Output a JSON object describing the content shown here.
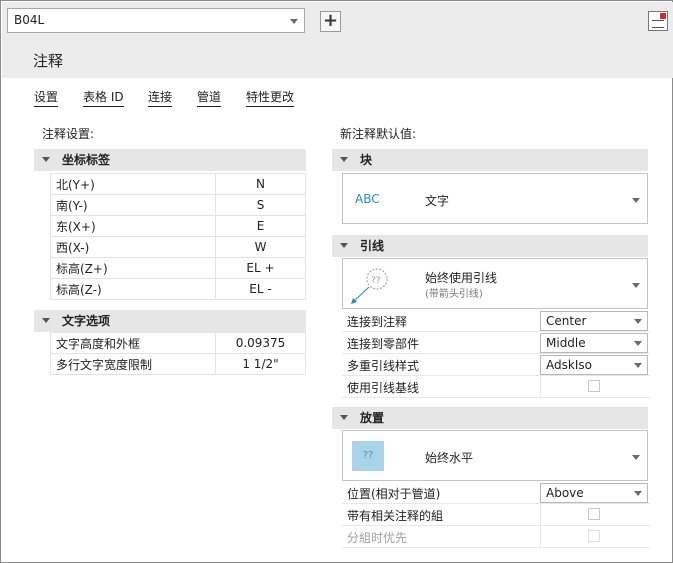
{
  "toolbar": {
    "style_combo_value": "B04L",
    "add_button_label": "+"
  },
  "page_title": "注释",
  "tabs": [
    {
      "label": "设置"
    },
    {
      "label": "表格 ID"
    },
    {
      "label": "连接"
    },
    {
      "label": "管道"
    },
    {
      "label": "特性更改"
    }
  ],
  "left": {
    "title": "注释设置:",
    "coord_group": {
      "header": "坐标标签",
      "rows": [
        {
          "label": "北(Y+)",
          "value": "N"
        },
        {
          "label": "南(Y-)",
          "value": "S"
        },
        {
          "label": "东(X+)",
          "value": "E"
        },
        {
          "label": "西(X-)",
          "value": "W"
        },
        {
          "label": "标高(Z+)",
          "value": "EL +"
        },
        {
          "label": "标高(Z-)",
          "value": "EL -"
        }
      ]
    },
    "text_group": {
      "header": "文字选项",
      "rows": [
        {
          "label": "文字高度和外框",
          "value": "0.09375"
        },
        {
          "label": "多行文字宽度限制",
          "value": "1 1/2\""
        }
      ]
    }
  },
  "right": {
    "title": "新注释默认值:",
    "block_group": {
      "header": "块",
      "preview_text": "ABC",
      "option_label": "文字"
    },
    "leader_group": {
      "header": "引线",
      "preview_text": "??",
      "option_label": "始终使用引线",
      "option_sublabel": "(带箭头引线)",
      "props": [
        {
          "label": "连接到注释",
          "value": "Center"
        },
        {
          "label": "连接到零部件",
          "value": "Middle"
        },
        {
          "label": "多重引线样式",
          "value": "AdskIso"
        },
        {
          "label": "使用引线基线",
          "checked": false
        }
      ]
    },
    "placement_group": {
      "header": "放置",
      "preview_text": "??",
      "option_label": "始终水平",
      "props": [
        {
          "label": "位置(相对于管道)",
          "value": "Above"
        },
        {
          "label": "带有相关注释的組",
          "checked": false
        },
        {
          "label": "分組时优先",
          "checked": false,
          "disabled": true
        }
      ]
    }
  },
  "colors": {
    "accent_text": "#2a8ab8",
    "preview_fill": "#a9d3e8"
  }
}
